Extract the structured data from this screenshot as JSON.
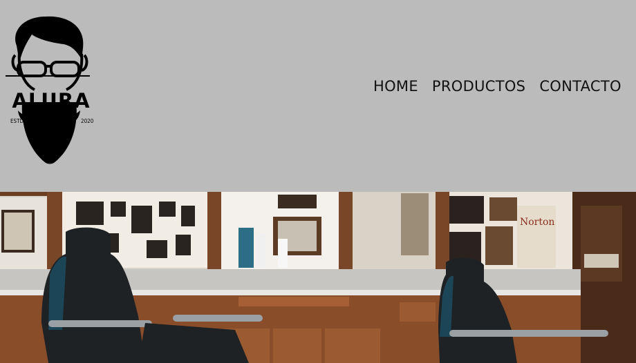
{
  "brand": {
    "name": "ALURA",
    "est_label": "ESTD",
    "year": "2020"
  },
  "nav": {
    "items": [
      {
        "label": "HOME"
      },
      {
        "label": "PRODUCTOS"
      },
      {
        "label": "CONTACTO"
      }
    ]
  },
  "hero": {
    "sign_text": "Norton"
  },
  "colors": {
    "header_bg": "#bbbbbb",
    "text": "#111111"
  }
}
